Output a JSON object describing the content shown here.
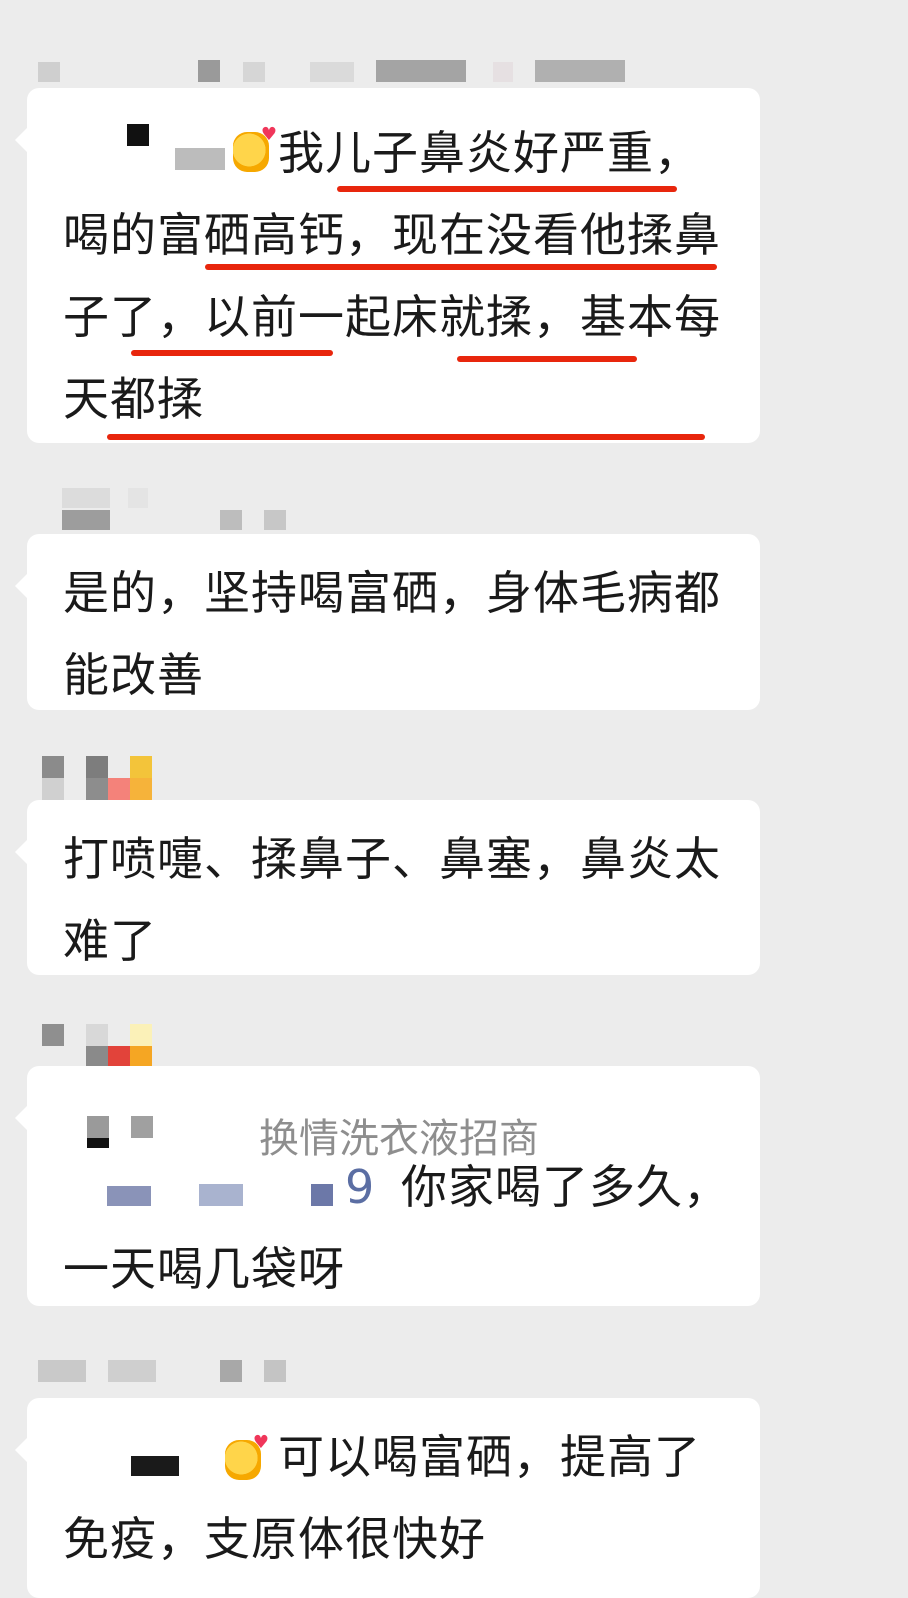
{
  "messages": [
    {
      "prefix_emoji": "smiling-face-with-hearts-icon",
      "text": "我儿子鼻炎好严重，喝的富硒高钙，现在没看他揉鼻子了，以前一起床就揉，基本每天都揉"
    },
    {
      "text": "是的，坚持喝富硒，身体毛病都能改善"
    },
    {
      "text": "打喷嚏、揉鼻子、鼻塞，鼻炎太难了"
    },
    {
      "quote_fragment": "换情洗衣液招商",
      "mention_fragment": "9",
      "text": "你家喝了多久，一天喝几袋呀"
    },
    {
      "prefix_emoji": "smiling-face-with-hearts-icon",
      "text": "可以喝富硒，提高了免疫，支原体很快好"
    }
  ],
  "colors": {
    "background": "#ececec",
    "bubble": "#ffffff",
    "underline": "#e8260d",
    "mention": "#5b6ea3"
  }
}
